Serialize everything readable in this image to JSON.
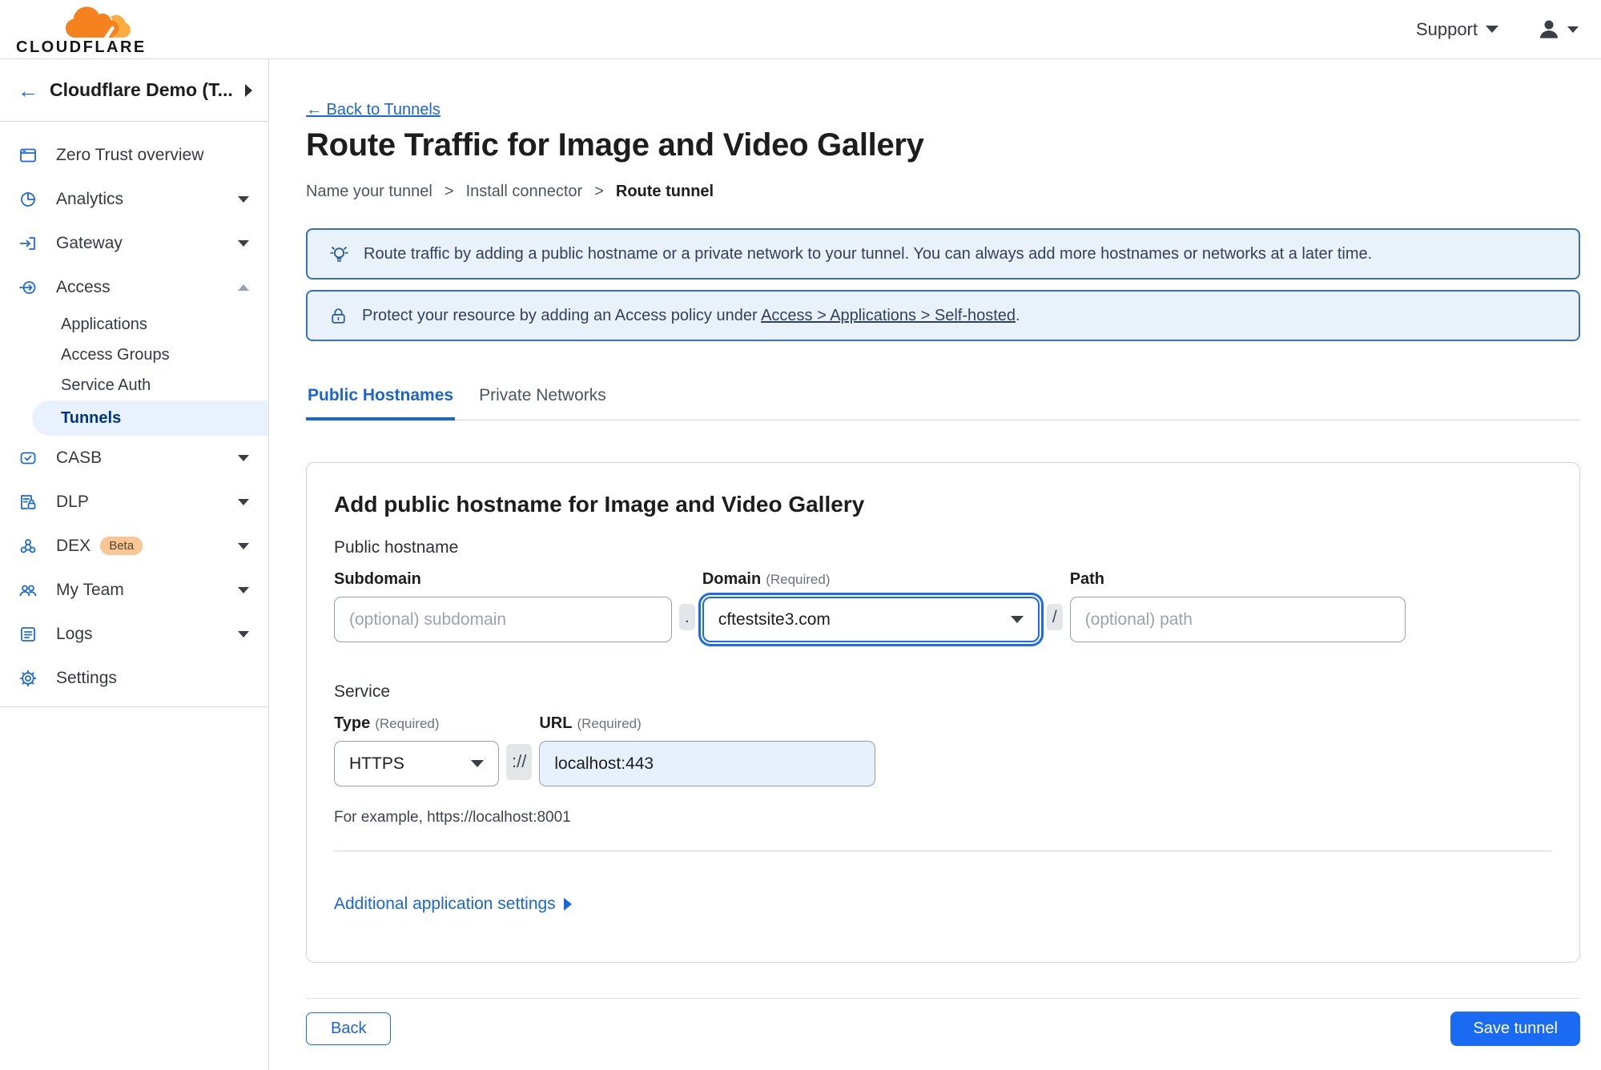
{
  "header": {
    "logo_text": "CLOUDFLARE",
    "support_label": "Support"
  },
  "sidebar": {
    "account_label": "Cloudflare Demo (T...",
    "back_arrow": "←",
    "items": [
      {
        "label": "Zero Trust overview"
      },
      {
        "label": "Analytics"
      },
      {
        "label": "Gateway"
      },
      {
        "label": "Access"
      },
      {
        "label": "Applications"
      },
      {
        "label": "Access Groups"
      },
      {
        "label": "Service Auth"
      },
      {
        "label": "Tunnels"
      },
      {
        "label": "CASB"
      },
      {
        "label": "DLP"
      },
      {
        "label": "DEX",
        "badge": "Beta"
      },
      {
        "label": "My Team"
      },
      {
        "label": "Logs"
      },
      {
        "label": "Settings"
      }
    ]
  },
  "page": {
    "back_link": "← Back to Tunnels",
    "title": "Route Traffic for Image and Video Gallery",
    "breadcrumb": {
      "step1": "Name your tunnel",
      "step2": "Install connector",
      "step3": "Route tunnel",
      "separator": ">"
    },
    "banners": {
      "tip": "Route traffic by adding a public hostname or a private network to your tunnel. You can always add more hostnames or networks at a later time.",
      "protect_prefix": "Protect your resource by adding an Access policy under",
      "protect_link": "Access > Applications > Self-hosted",
      "protect_suffix": "."
    },
    "tabs": {
      "public": "Public Hostnames",
      "private": "Private Networks"
    }
  },
  "card": {
    "heading": "Add public hostname for Image and Video Gallery",
    "public_hostname_label": "Public hostname",
    "subdomain_label": "Subdomain",
    "subdomain_placeholder": "(optional) subdomain",
    "domain_label": "Domain",
    "domain_required": "(Required)",
    "domain_value": "cftestsite3.com",
    "path_label": "Path",
    "path_placeholder": "(optional) path",
    "dot_separator": ".",
    "slash_separator": "/",
    "scheme_separator": "://",
    "service_label": "Service",
    "type_label": "Type",
    "type_required": "(Required)",
    "type_value": "HTTPS",
    "url_label": "URL",
    "url_required": "(Required)",
    "url_value": "localhost:443",
    "example": "For example, https://localhost:8001",
    "additional_settings": "Additional application settings"
  },
  "footer": {
    "back": "Back",
    "save": "Save tunnel"
  },
  "colors": {
    "accent_blue": "#1a6af4",
    "link_blue": "#1a66e0",
    "banner_bg": "#e9f2fb",
    "banner_border": "#3a71b2",
    "sidebar_active_bg": "#e9f2fc",
    "sidebar_active_text": "#003681",
    "brand_orange": "#f6821f",
    "brand_orange_light": "#fbad41",
    "beta_badge_bg": "#fac696"
  }
}
